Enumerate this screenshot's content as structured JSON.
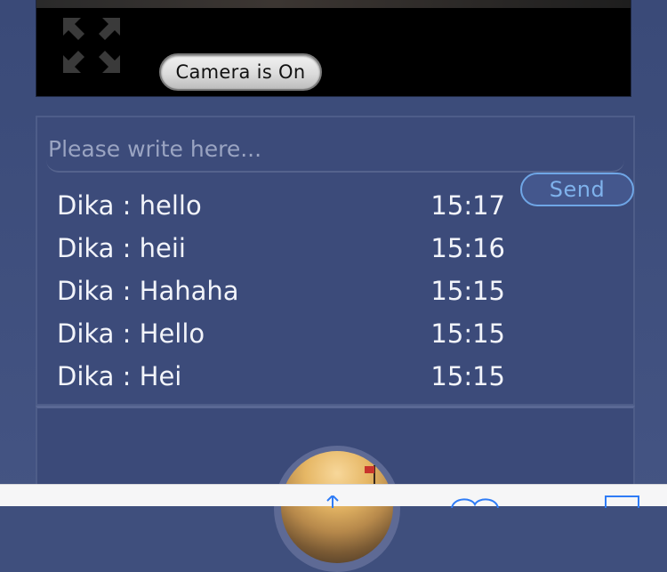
{
  "video": {
    "camera_button_label": "Camera is On"
  },
  "chat": {
    "input_placeholder": "Please write here...",
    "send_label": "Send",
    "messages": [
      {
        "text": "Dika : hello",
        "time": "15:17"
      },
      {
        "text": "Dika : heii",
        "time": "15:16"
      },
      {
        "text": "Dika : Hahaha",
        "time": "15:15"
      },
      {
        "text": "Dika : Hello",
        "time": "15:15"
      },
      {
        "text": "Dika : Hei",
        "time": "15:15"
      }
    ]
  },
  "colors": {
    "background": "#3f4f7d",
    "send_accent": "#7fb2ec",
    "message_text": "#f2f4fa"
  },
  "toolbar": {
    "icons": [
      "share-icon",
      "bookmarks-icon",
      "tabs-icon"
    ]
  }
}
